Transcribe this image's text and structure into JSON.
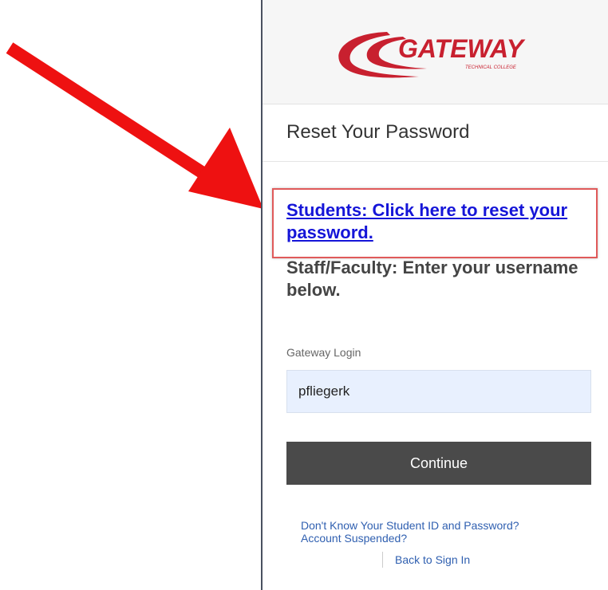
{
  "logo": {
    "name": "GATEWAY",
    "tagline": "TECHNICAL COLLEGE",
    "color": "#c8202f"
  },
  "page": {
    "title": "Reset Your Password"
  },
  "students_link": "Students: Click here to reset your password.",
  "staff_instructions": "Staff/Faculty: Enter your username below.",
  "login": {
    "label": "Gateway Login",
    "value": "pfliegerk"
  },
  "continue_label": "Continue",
  "help": {
    "line1": "Don't Know Your Student ID and Password?",
    "line2": "Account Suspended?"
  },
  "back_label": "Back to Sign In",
  "colors": {
    "arrow": "#ee1111",
    "highlight_box": "#e05a5a",
    "link": "#1515d8",
    "button": "#4a4a4a"
  }
}
